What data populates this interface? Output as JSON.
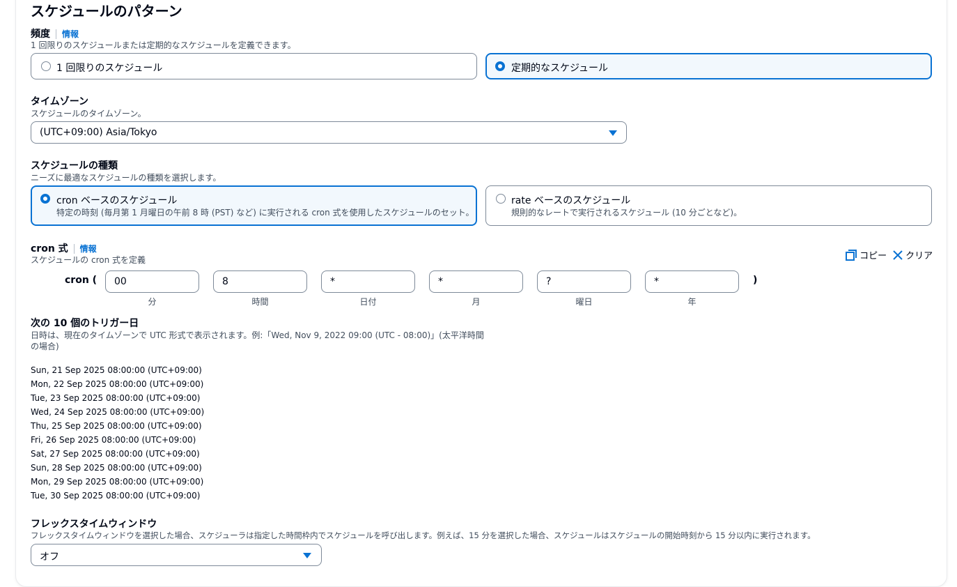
{
  "section_title": "スケジュールのパターン",
  "frequency": {
    "label": "頻度",
    "info": "情報",
    "description": "1 回限りのスケジュールまたは定期的なスケジュールを定義できます。",
    "options": [
      "1 回限りのスケジュール",
      "定期的なスケジュール"
    ],
    "selected": "定期的なスケジュール"
  },
  "timezone": {
    "label": "タイムゾーン",
    "description": "スケジュールのタイムゾーン。",
    "value": "(UTC+09:00) Asia/Tokyo"
  },
  "schedule_type": {
    "label": "スケジュールの種類",
    "description": "ニーズに最適なスケジュールの種類を選択します。",
    "cron_title": "cron ベースのスケジュール",
    "cron_desc": "特定の時刻 (毎月第 1 月曜日の午前 8 時 (PST) など) に実行される cron 式を使用したスケジュールのセット。",
    "rate_title": "rate ベースのスケジュール",
    "rate_desc": "規則的なレートで実行されるスケジュール (10 分ごとなど)。",
    "selected": "cron ベースのスケジュール"
  },
  "cron": {
    "label": "cron 式",
    "info": "情報",
    "description": "スケジュールの cron 式を定義",
    "copy_label": "コピー",
    "clear_label": "クリア",
    "open": "cron (",
    "close": ")",
    "fields": [
      {
        "value": "00",
        "caption": "分"
      },
      {
        "value": "8",
        "caption": "時間"
      },
      {
        "value": "*",
        "caption": "日付"
      },
      {
        "value": "*",
        "caption": "月"
      },
      {
        "value": "?",
        "caption": "曜日"
      },
      {
        "value": "*",
        "caption": "年"
      }
    ]
  },
  "triggers": {
    "label": "次の 10 個のトリガー日",
    "description_line1": "日時は、現在のタイムゾーンで UTC 形式で表示されます。例:「Wed, Nov 9, 2022 09:00 (UTC - 08:00)」(太平洋時間",
    "description_line2": "の場合)",
    "dates": [
      "Sun, 21 Sep 2025 08:00:00 (UTC+09:00)",
      "Mon, 22 Sep 2025 08:00:00 (UTC+09:00)",
      "Tue, 23 Sep 2025 08:00:00 (UTC+09:00)",
      "Wed, 24 Sep 2025 08:00:00 (UTC+09:00)",
      "Thu, 25 Sep 2025 08:00:00 (UTC+09:00)",
      "Fri, 26 Sep 2025 08:00:00 (UTC+09:00)",
      "Sat, 27 Sep 2025 08:00:00 (UTC+09:00)",
      "Sun, 28 Sep 2025 08:00:00 (UTC+09:00)",
      "Mon, 29 Sep 2025 08:00:00 (UTC+09:00)",
      "Tue, 30 Sep 2025 08:00:00 (UTC+09:00)"
    ]
  },
  "flex": {
    "label": "フレックスタイムウィンドウ",
    "description": "フレックスタイムウィンドウを選択した場合、スケジューラは指定した時間枠内でスケジュールを呼び出します。例えば、15 分を選択した場合、スケジュールはスケジュールの開始時刻から 15 分以内に実行されます。",
    "value": "オフ"
  },
  "colors": {
    "accent": "#0972d3",
    "selected_bg": "#f2f8fd",
    "border": "#7d8998",
    "text": "#000716",
    "secondary_text": "#414d5c"
  },
  "icons": [
    "copy-icon",
    "close-icon",
    "caret-down-icon"
  ]
}
